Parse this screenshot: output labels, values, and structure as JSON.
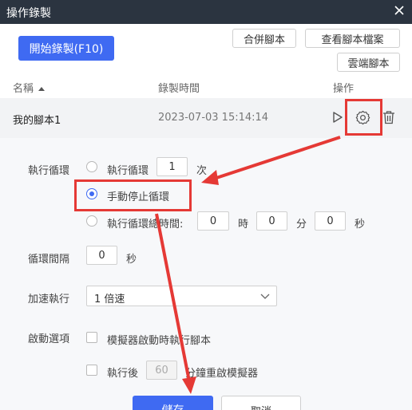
{
  "window": {
    "title": "操作錄製"
  },
  "toolbar": {
    "record_label": "開始錄製(F10)",
    "merge_label": "合併腳本",
    "view_archive_label": "查看腳本檔案",
    "cloud_label": "雲端腳本"
  },
  "table": {
    "columns": {
      "name": "名稱",
      "time": "錄製時間",
      "action": "操作"
    },
    "rows": [
      {
        "name": "我的腳本1",
        "time": "2023-07-03 15:14:14"
      }
    ]
  },
  "settings": {
    "loop": {
      "label": "執行循環",
      "opt1_label": "執行循環",
      "opt1_value": "1",
      "opt1_unit": "次",
      "opt2_label": "手動停止循環",
      "opt3_label": "執行循環總時間:",
      "hours": "0",
      "hours_unit": "時",
      "minutes": "0",
      "minutes_unit": "分",
      "seconds": "0",
      "seconds_unit": "秒",
      "selected": "手動停止循環"
    },
    "interval": {
      "label": "循環間隔",
      "value": "0",
      "unit": "秒"
    },
    "speed": {
      "label": "加速執行",
      "selected": "1 倍速"
    },
    "startup": {
      "label": "啟動選項",
      "opt1_label": "模擬器啟動時執行腳本",
      "opt2_prefix": "執行後",
      "opt2_value": "60",
      "opt2_suffix": "分鐘重啟模擬器"
    },
    "save_label": "儲存",
    "cancel_label": "取消"
  },
  "colors": {
    "accent": "#3f6af2",
    "titlebar": "#2b3440",
    "annotation": "#e53935"
  },
  "icons": [
    "close-icon",
    "sort-up-icon",
    "play-icon",
    "gear-icon",
    "trash-icon",
    "chevron-down-icon"
  ]
}
